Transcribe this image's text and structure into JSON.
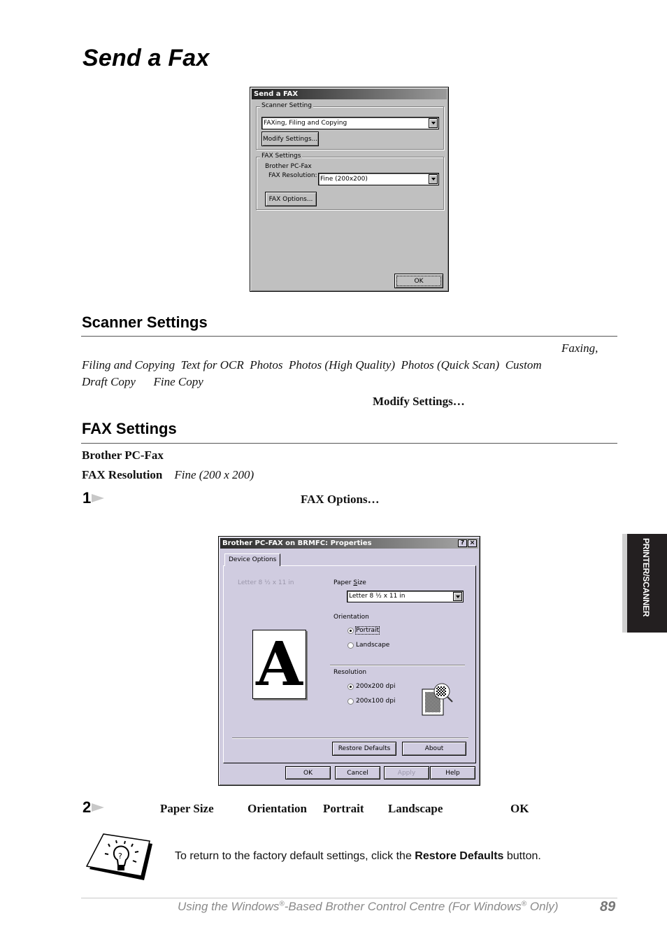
{
  "page": {
    "title": "Send a Fax",
    "side_tab": "PRINTER/SCANNER",
    "page_number": "89",
    "footer": {
      "part1": "Using the Windows",
      "reg": "®",
      "part2": "-Based Brother Control Centre (For Windows",
      "part3": " Only)"
    }
  },
  "dialog1": {
    "title": "Send a FAX",
    "scanner_group": "Scanner Setting",
    "scanner_combo_value": "FAXing, Filing and Copying",
    "modify_button": "Modify Settings...",
    "fax_group": "FAX Settings",
    "fax_device": "Brother PC-Fax",
    "resolution_label": "FAX Resolution:",
    "resolution_value": "Fine (200x200)",
    "fax_options_button": "FAX Options...",
    "ok_button": "OK"
  },
  "scanner_section": {
    "heading": "Scanner Settings",
    "line1_italic": "Faxing,",
    "options_line2": [
      "Filing and Copying",
      "Text for OCR",
      "Photos",
      "Photos (High Quality)",
      "Photos (Quick Scan)",
      "Custom"
    ],
    "options_line3": [
      "Draft Copy",
      "Fine Copy"
    ],
    "modify_ref": "Modify Settings…"
  },
  "fax_section": {
    "heading": "FAX Settings",
    "device": "Brother PC-Fax",
    "resolution_label": "FAX Resolution",
    "resolution_value": "Fine (200 x 200)"
  },
  "step1": {
    "number": "1",
    "ref": "FAX Options…"
  },
  "dialog2": {
    "title": "Brother PC-FAX on BRMFC: Properties",
    "help_btn": "?",
    "close_btn": "×",
    "tab": "Device Options",
    "preview_caption": "Letter 8 ½ x 11 in",
    "preview_glyph": "A",
    "paper_size_label_pre": "Paper ",
    "paper_size_label_ul": "S",
    "paper_size_label_post": "ize",
    "paper_size_value": "Letter 8 ½ x 11 in",
    "orientation_label": "Orientation",
    "orientation_options": [
      {
        "label": "Portrait",
        "selected": true
      },
      {
        "label": "Landscape",
        "selected": false
      }
    ],
    "resolution_label": "Resolution",
    "resolution_options": [
      {
        "label": "200x200 dpi",
        "selected": true
      },
      {
        "label": "200x100 dpi",
        "selected": false
      }
    ],
    "restore_button": "Restore Defaults",
    "about_button": "About",
    "ok_button": "OK",
    "cancel_button": "Cancel",
    "apply_button": "Apply",
    "help_button": "Help"
  },
  "step2": {
    "number": "2",
    "refs": [
      "Paper Size",
      "Orientation",
      "Portrait",
      "Landscape",
      "OK"
    ]
  },
  "note": {
    "text_pre": "To return to the factory default settings, click the ",
    "text_bold": "Restore Defaults",
    "text_post": " button."
  }
}
